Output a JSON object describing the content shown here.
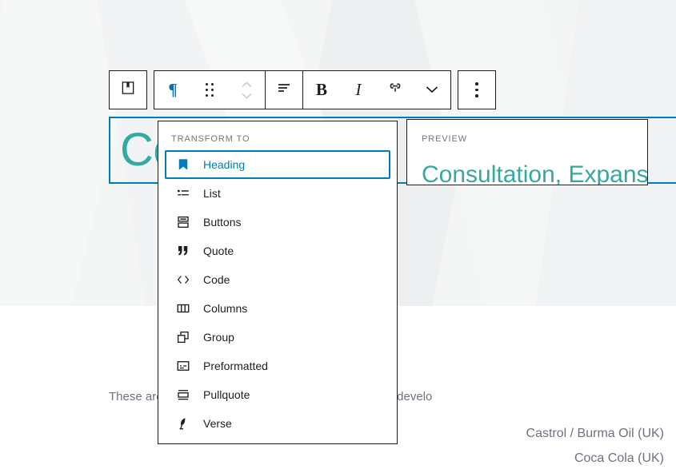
{
  "document": {
    "heading_text": "Consultation",
    "body_paragraph": "These are  has travelled to worked with - helping them develo",
    "body_paragraph_left": "These ar",
    "body_paragraph_right": "has travelled to worked with - helping them develo",
    "clients": [
      "Castrol / Burma Oil (UK)",
      "Coca Cola (UK)"
    ]
  },
  "toolbar": {
    "block_type_icon": "book-bookmark-icon",
    "paragraph_icon": "paragraph-icon",
    "paragraph_glyph": "¶",
    "drag_icon": "drag-handle-icon",
    "move_icon": "move-up-down-icon",
    "align_icon": "align-text-icon",
    "bold_label": "B",
    "italic_label": "I",
    "link_icon": "link-icon",
    "more_formatting_icon": "chevron-down-icon",
    "options_icon": "more-options-vertical-icon"
  },
  "transform_menu": {
    "section_label": "TRANSFORM TO",
    "items": [
      {
        "label": "Heading",
        "icon": "heading-bookmark-icon",
        "selected": true
      },
      {
        "label": "List",
        "icon": "list-icon",
        "selected": false
      },
      {
        "label": "Buttons",
        "icon": "buttons-icon",
        "selected": false
      },
      {
        "label": "Quote",
        "icon": "quote-icon",
        "selected": false
      },
      {
        "label": "Code",
        "icon": "code-icon",
        "selected": false
      },
      {
        "label": "Columns",
        "icon": "columns-icon",
        "selected": false
      },
      {
        "label": "Group",
        "icon": "group-icon",
        "selected": false
      },
      {
        "label": "Preformatted",
        "icon": "preformatted-icon",
        "selected": false
      },
      {
        "label": "Pullquote",
        "icon": "pullquote-icon",
        "selected": false
      },
      {
        "label": "Verse",
        "icon": "verse-feather-icon",
        "selected": false
      }
    ]
  },
  "preview": {
    "label": "PREVIEW",
    "heading_text": "Consultation, Expansi"
  },
  "colors": {
    "accent_blue": "#007cba",
    "heading_teal": "#35a8a0",
    "toolbar_border": "#1e1e1e",
    "muted_text": "#757575",
    "body_text": "#6b7280",
    "page_bg_top": "#f4f5f5",
    "page_bg_bottom": "#ffffff"
  }
}
